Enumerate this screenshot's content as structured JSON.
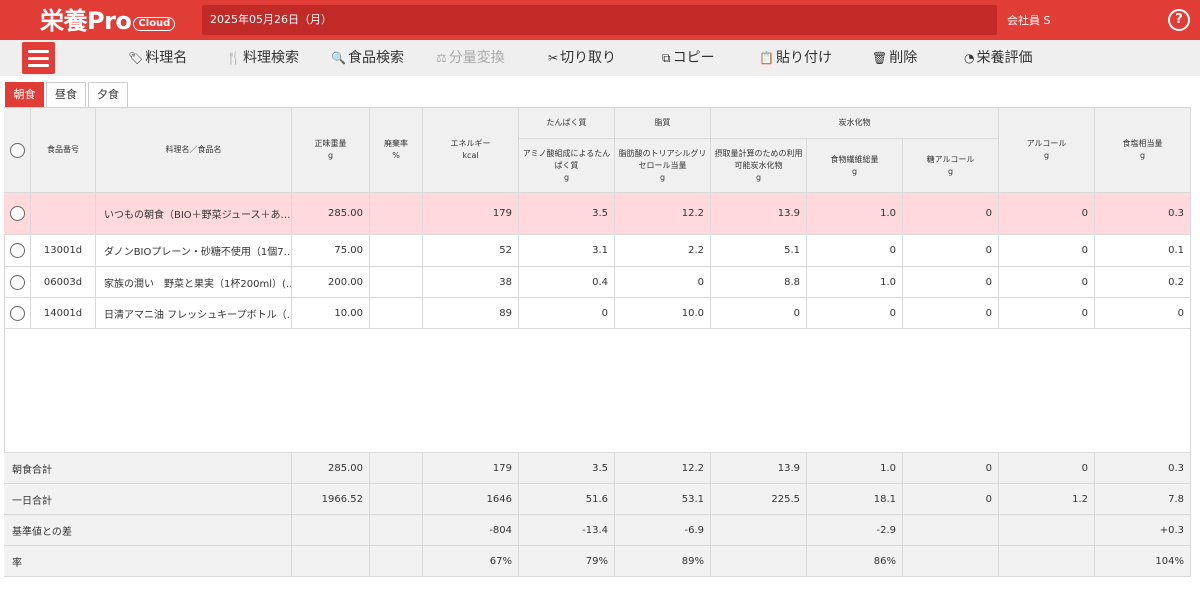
{
  "app": {
    "logo_main": "栄養Pro",
    "logo_sub": "Cloud",
    "date": "2025年05月26日（月）",
    "user": "会社員 S",
    "help": "?"
  },
  "toolbar": [
    {
      "label": "料理名",
      "icon": "tag-icon",
      "glyph": "🏷"
    },
    {
      "label": "料理検索",
      "icon": "fork-knife-icon",
      "glyph": "🍴"
    },
    {
      "label": "食品検索",
      "icon": "search-icon",
      "glyph": "🔍"
    },
    {
      "label": "分量変換",
      "icon": "scale-icon",
      "glyph": "⚖"
    },
    {
      "label": "切り取り",
      "icon": "scissors-icon",
      "glyph": "✂"
    },
    {
      "label": "コピー",
      "icon": "copy-icon",
      "glyph": "⧉"
    },
    {
      "label": "貼り付け",
      "icon": "paste-icon",
      "glyph": "📋"
    },
    {
      "label": "削除",
      "icon": "trash-icon",
      "glyph": "🗑"
    },
    {
      "label": "栄養評価",
      "icon": "pie-chart-icon",
      "glyph": "◔"
    }
  ],
  "tabs": [
    "朝食",
    "昼食",
    "夕食"
  ],
  "headers": {
    "food_no": "食品番号",
    "name": "料理名／食品名",
    "weight": "正味重量",
    "weight_unit": "g",
    "waste": "廃棄率",
    "waste_unit": "%",
    "energy": "エネルギー",
    "energy_unit": "kcal",
    "protein_group": "たんぱく質",
    "protein": "アミノ酸組成によるたんぱく質",
    "protein_unit": "g",
    "fat_group": "脂質",
    "fat": "脂肪酸のトリアシルグリセロール当量",
    "fat_unit": "g",
    "carb_group": "炭水化物",
    "carb_avail": "摂取量計算のための利用可能炭水化物",
    "carb_avail_unit": "g",
    "fiber": "食物繊維総量",
    "fiber_unit": "g",
    "sugar_alcohol": "糖アルコール",
    "sugar_alcohol_unit": "g",
    "alcohol": "アルコール",
    "alcohol_unit": "g",
    "salt": "食塩相当量",
    "salt_unit": "g"
  },
  "rows": [
    {
      "no": "",
      "name": "いつもの朝食（BIO＋野菜ジュース＋あ…",
      "weight": "285.00",
      "waste": "",
      "energy": "179",
      "protein": "3.5",
      "fat": "12.2",
      "carb": "13.9",
      "fiber": "1.0",
      "sugar_alcohol": "0",
      "alcohol": "0",
      "salt": "0.3"
    },
    {
      "no": "13001d",
      "name": "ダノンBIOプレーン・砂糖不使用（1個7…",
      "weight": "75.00",
      "waste": "",
      "energy": "52",
      "protein": "3.1",
      "fat": "2.2",
      "carb": "5.1",
      "fiber": "0",
      "sugar_alcohol": "0",
      "alcohol": "0",
      "salt": "0.1"
    },
    {
      "no": "06003d",
      "name": "家族の潤い　野菜と果実（1杯200ml）(…",
      "weight": "200.00",
      "waste": "",
      "energy": "38",
      "protein": "0.4",
      "fat": "0",
      "carb": "8.8",
      "fiber": "1.0",
      "sugar_alcohol": "0",
      "alcohol": "0",
      "salt": "0.2"
    },
    {
      "no": "14001d",
      "name": "日清アマニ油 フレッシュキープボトル（…",
      "weight": "10.00",
      "waste": "",
      "energy": "89",
      "protein": "0",
      "fat": "10.0",
      "carb": "0",
      "fiber": "0",
      "sugar_alcohol": "0",
      "alcohol": "0",
      "salt": "0"
    }
  ],
  "footer": [
    {
      "label": "朝食合計",
      "weight": "285.00",
      "waste": "",
      "energy": "179",
      "protein": "3.5",
      "fat": "12.2",
      "carb": "13.9",
      "fiber": "1.0",
      "sugar_alcohol": "0",
      "alcohol": "0",
      "salt": "0.3"
    },
    {
      "label": "一日合計",
      "weight": "1966.52",
      "waste": "",
      "energy": "1646",
      "protein": "51.6",
      "fat": "53.1",
      "carb": "225.5",
      "fiber": "18.1",
      "sugar_alcohol": "0",
      "alcohol": "1.2",
      "salt": "7.8"
    },
    {
      "label": "基準値との差",
      "weight": "",
      "waste": "",
      "energy": "-804",
      "protein": "-13.4",
      "fat": "-6.9",
      "carb": "",
      "fiber": "-2.9",
      "sugar_alcohol": "",
      "alcohol": "",
      "salt": "+0.3"
    },
    {
      "label": "率",
      "weight": "",
      "waste": "",
      "energy": "67%",
      "protein": "79%",
      "fat": "89%",
      "carb": "",
      "fiber": "86%",
      "sugar_alcohol": "",
      "alcohol": "",
      "salt": "104%"
    }
  ]
}
